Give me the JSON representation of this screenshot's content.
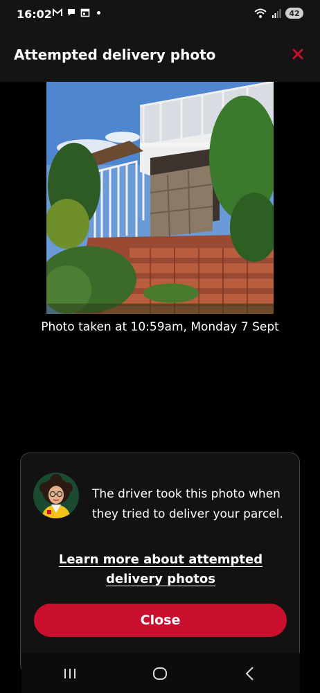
{
  "status_bar": {
    "time": "16:02",
    "notification_icons": [
      "gmail-icon",
      "chat-icon",
      "calendar-icon"
    ],
    "battery_level": "42"
  },
  "header": {
    "title": "Attempted delivery photo",
    "close_icon": "close-icon"
  },
  "photo": {
    "caption": "Photo taken at 10:59am, Monday 7 Sept"
  },
  "info_sheet": {
    "description": "The driver took this photo when they tried to deliver your parcel.",
    "learn_more_line1": "Learn more about attempted",
    "learn_more_line2": "delivery photos",
    "close_label": "Close"
  },
  "colors": {
    "accent": "#c8102e",
    "avatar_bg": "#1b4a33"
  }
}
